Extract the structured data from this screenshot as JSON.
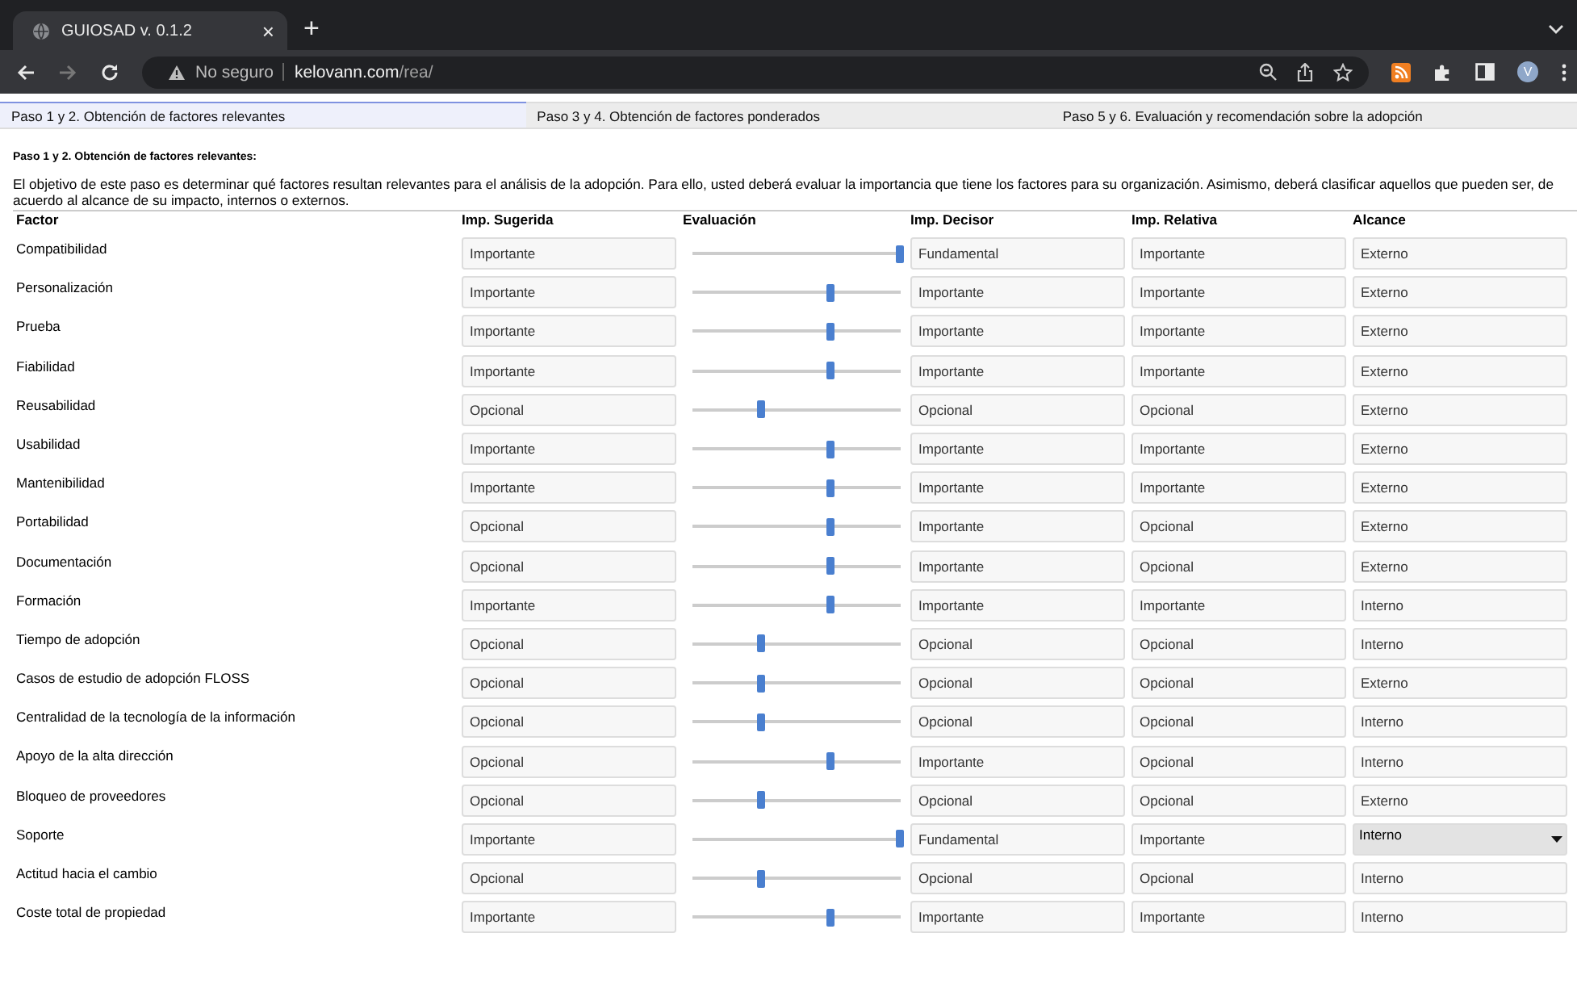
{
  "browser": {
    "tab_title": "GUIOSAD v. 0.1.2",
    "close": "×",
    "new_tab": "+",
    "security": "No seguro",
    "url_host": "kelovann.com",
    "url_path": "/rea/",
    "avatar": "V"
  },
  "tabs": [
    {
      "label": "Paso 1 y 2. Obtención de factores relevantes",
      "selected": true
    },
    {
      "label": "Paso 3 y 4. Obtención de factores ponderados",
      "selected": false
    },
    {
      "label": "Paso 5 y 6. Evaluación y recomendación sobre la adopción",
      "selected": false
    }
  ],
  "heading": "Paso 1 y 2. Obtención de factores relevantes:",
  "description": "El objetivo de este paso es determinar qué factores resultan relevantes para el análisis de la adopción. Para ello, usted deberá evaluar la importancia que tiene los factores para su organización. Asimismo, deberá clasificar aquellos que pueden ser, de acuerdo al alcance de su impacto, internos o externos.",
  "table": {
    "columns": [
      "Factor",
      "Imp. Sugerida",
      "Evaluación",
      "Imp. Decisor",
      "Imp. Relativa",
      "Alcance"
    ],
    "rows": [
      {
        "factor": "Compatibilidad",
        "sugerida": "Importante",
        "level": 1,
        "decisor": "Fundamental",
        "relativa": "Importante",
        "alcance": {
          "value": "Externo",
          "kind": "field"
        }
      },
      {
        "factor": "Personalización",
        "sugerida": "Importante",
        "level": 0.667,
        "decisor": "Importante",
        "relativa": "Importante",
        "alcance": {
          "value": "Externo",
          "kind": "field"
        }
      },
      {
        "factor": "Prueba",
        "sugerida": "Importante",
        "level": 0.667,
        "decisor": "Importante",
        "relativa": "Importante",
        "alcance": {
          "value": "Externo",
          "kind": "field"
        }
      },
      {
        "factor": "Fiabilidad",
        "sugerida": "Importante",
        "level": 0.667,
        "decisor": "Importante",
        "relativa": "Importante",
        "alcance": {
          "value": "Externo",
          "kind": "field"
        }
      },
      {
        "factor": "Reusabilidad",
        "sugerida": "Opcional",
        "level": 0.333,
        "decisor": "Opcional",
        "relativa": "Opcional",
        "alcance": {
          "value": "Externo",
          "kind": "field"
        }
      },
      {
        "factor": "Usabilidad",
        "sugerida": "Importante",
        "level": 0.667,
        "decisor": "Importante",
        "relativa": "Importante",
        "alcance": {
          "value": "Externo",
          "kind": "field"
        }
      },
      {
        "factor": "Mantenibilidad",
        "sugerida": "Importante",
        "level": 0.667,
        "decisor": "Importante",
        "relativa": "Importante",
        "alcance": {
          "value": "Externo",
          "kind": "field"
        }
      },
      {
        "factor": "Portabilidad",
        "sugerida": "Opcional",
        "level": 0.667,
        "decisor": "Importante",
        "relativa": "Opcional",
        "alcance": {
          "value": "Externo",
          "kind": "field"
        }
      },
      {
        "factor": "Documentación",
        "sugerida": "Opcional",
        "level": 0.667,
        "decisor": "Importante",
        "relativa": "Opcional",
        "alcance": {
          "value": "Externo",
          "kind": "field"
        }
      },
      {
        "factor": "Formación",
        "sugerida": "Importante",
        "level": 0.667,
        "decisor": "Importante",
        "relativa": "Importante",
        "alcance": {
          "value": "Interno",
          "kind": "field"
        }
      },
      {
        "factor": "Tiempo de adopción",
        "sugerida": "Opcional",
        "level": 0.333,
        "decisor": "Opcional",
        "relativa": "Opcional",
        "alcance": {
          "value": "Interno",
          "kind": "field"
        }
      },
      {
        "factor": "Casos de estudio de adopción FLOSS",
        "sugerida": "Opcional",
        "level": 0.333,
        "decisor": "Opcional",
        "relativa": "Opcional",
        "alcance": {
          "value": "Externo",
          "kind": "field"
        }
      },
      {
        "factor": "Centralidad de la tecnología de la información",
        "sugerida": "Opcional",
        "level": 0.333,
        "decisor": "Opcional",
        "relativa": "Opcional",
        "alcance": {
          "value": "Interno",
          "kind": "field"
        }
      },
      {
        "factor": "Apoyo de la alta dirección",
        "sugerida": "Opcional",
        "level": 0.667,
        "decisor": "Importante",
        "relativa": "Opcional",
        "alcance": {
          "value": "Interno",
          "kind": "field"
        }
      },
      {
        "factor": "Bloqueo de proveedores",
        "sugerida": "Opcional",
        "level": 0.333,
        "decisor": "Opcional",
        "relativa": "Opcional",
        "alcance": {
          "value": "Externo",
          "kind": "field"
        }
      },
      {
        "factor": "Soporte",
        "sugerida": "Importante",
        "level": 1,
        "decisor": "Fundamental",
        "relativa": "Importante",
        "alcance": {
          "value": "Interno",
          "kind": "select"
        }
      },
      {
        "factor": "Actitud hacia el cambio",
        "sugerida": "Opcional",
        "level": 0.333,
        "decisor": "Opcional",
        "relativa": "Opcional",
        "alcance": {
          "value": "Interno",
          "kind": "field"
        }
      },
      {
        "factor": "Coste total de propiedad",
        "sugerida": "Importante",
        "level": 0.667,
        "decisor": "Importante",
        "relativa": "Importante",
        "alcance": {
          "value": "Interno",
          "kind": "field"
        }
      }
    ]
  }
}
